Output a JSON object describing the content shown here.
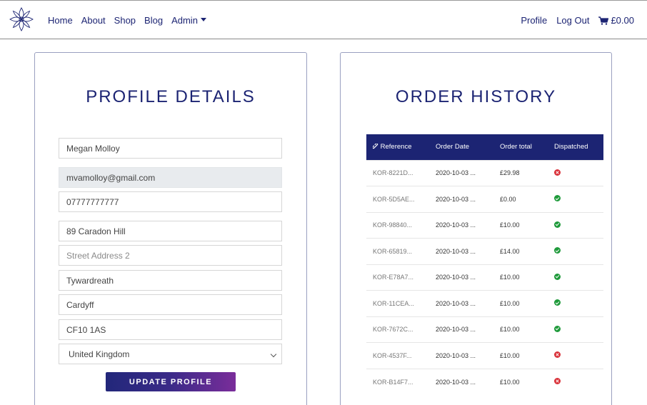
{
  "nav": {
    "links": [
      "Home",
      "About",
      "Shop",
      "Blog",
      "Admin"
    ],
    "profile": "Profile",
    "logout": "Log Out",
    "cart_total": "£0.00"
  },
  "profile": {
    "title": "PROFILE DETAILS",
    "full_name": "Megan Molloy",
    "email": "mvamolloy@gmail.com",
    "phone": "07777777777",
    "street1": "89 Caradon Hill",
    "street2_placeholder": "Street Address 2",
    "town": "Tywardreath",
    "county": "Cardyff",
    "postcode": "CF10 1AS",
    "country": "United Kingdom",
    "button": "UPDATE PROFILE"
  },
  "orders": {
    "title": "ORDER HISTORY",
    "headers": [
      "Reference",
      "Order Date",
      "Order total",
      "Dispatched"
    ],
    "rows": [
      {
        "ref": "KOR-8221D...",
        "date": "2020-10-03 ...",
        "total": "£29.98",
        "dispatched": false
      },
      {
        "ref": "KOR-5D5AE...",
        "date": "2020-10-03 ...",
        "total": "£0.00",
        "dispatched": true
      },
      {
        "ref": "KOR-98840...",
        "date": "2020-10-03 ...",
        "total": "£10.00",
        "dispatched": true
      },
      {
        "ref": "KOR-65819...",
        "date": "2020-10-03 ...",
        "total": "£14.00",
        "dispatched": true
      },
      {
        "ref": "KOR-E78A7...",
        "date": "2020-10-03 ...",
        "total": "£10.00",
        "dispatched": true
      },
      {
        "ref": "KOR-11CEA...",
        "date": "2020-10-03 ...",
        "total": "£10.00",
        "dispatched": true
      },
      {
        "ref": "KOR-7672C...",
        "date": "2020-10-03 ...",
        "total": "£10.00",
        "dispatched": true
      },
      {
        "ref": "KOR-4537F...",
        "date": "2020-10-03 ...",
        "total": "£10.00",
        "dispatched": false
      },
      {
        "ref": "KOR-B14F7...",
        "date": "2020-10-03 ...",
        "total": "£10.00",
        "dispatched": false
      }
    ]
  },
  "colors": {
    "brand": "#1c2473",
    "success": "#1f9a3b",
    "danger": "#d9323a"
  }
}
